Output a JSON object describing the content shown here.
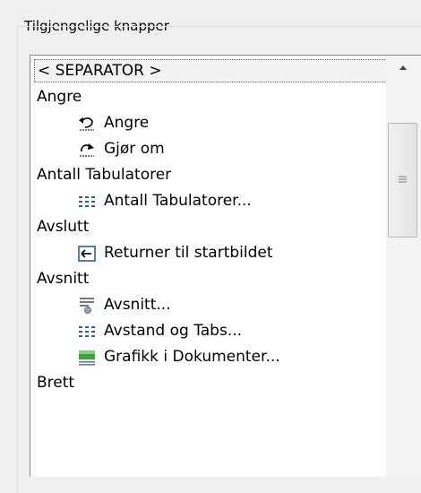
{
  "group": {
    "title": "Tilgjengelige knapper"
  },
  "list": {
    "items": [
      {
        "label": "< SEPARATOR >",
        "icon": ""
      },
      {
        "label": "Angre",
        "icon": ""
      },
      {
        "label": "Angre",
        "icon": "undo-icon"
      },
      {
        "label": "Gjør om",
        "icon": "redo-icon"
      },
      {
        "label": "Antall Tabulatorer",
        "icon": ""
      },
      {
        "label": "Antall Tabulatorer...",
        "icon": "tabs-grid-icon"
      },
      {
        "label": "Avslutt",
        "icon": ""
      },
      {
        "label": "Returner til startbildet",
        "icon": "return-icon"
      },
      {
        "label": "Avsnitt",
        "icon": ""
      },
      {
        "label": "Avsnitt...",
        "icon": "paragraph-icon"
      },
      {
        "label": "Avstand og Tabs...",
        "icon": "tabs-grid-icon"
      },
      {
        "label": "Grafikk i Dokumenter...",
        "icon": "graphics-icon"
      },
      {
        "label": "Brett",
        "icon": ""
      }
    ]
  },
  "colors": {
    "window_bg": "#f0f0f0",
    "list_bg": "#ffffff",
    "selection_bg": "#f2f2f2",
    "icon_blue": "#2a5fa0",
    "icon_green": "#3aa63a"
  }
}
